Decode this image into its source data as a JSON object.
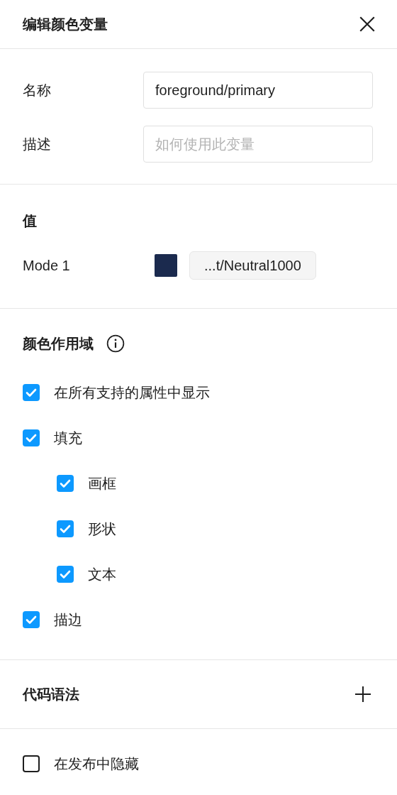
{
  "header": {
    "title": "编辑颜色变量"
  },
  "fields": [
    {
      "label": "名称",
      "value": "foreground/primary"
    },
    {
      "label": "描述",
      "placeholder": "如何使用此变量"
    }
  ],
  "value_section": {
    "title": "值",
    "modes": [
      {
        "name": "Mode 1",
        "color": "#1b2a4e",
        "value": "...t/Neutral1000"
      }
    ]
  },
  "scope": {
    "title": "颜色作用域",
    "items": [
      {
        "label": "在所有支持的属性中显示",
        "checked": true
      },
      {
        "label": "填充",
        "checked": true,
        "children": [
          {
            "label": "画框",
            "checked": true
          },
          {
            "label": "形状",
            "checked": true
          },
          {
            "label": "文本",
            "checked": true
          }
        ]
      },
      {
        "label": "描边",
        "checked": true
      }
    ]
  },
  "code_syntax": {
    "title": "代码语法"
  },
  "hide_in_publish": {
    "label": "在发布中隐藏",
    "checked": false
  }
}
